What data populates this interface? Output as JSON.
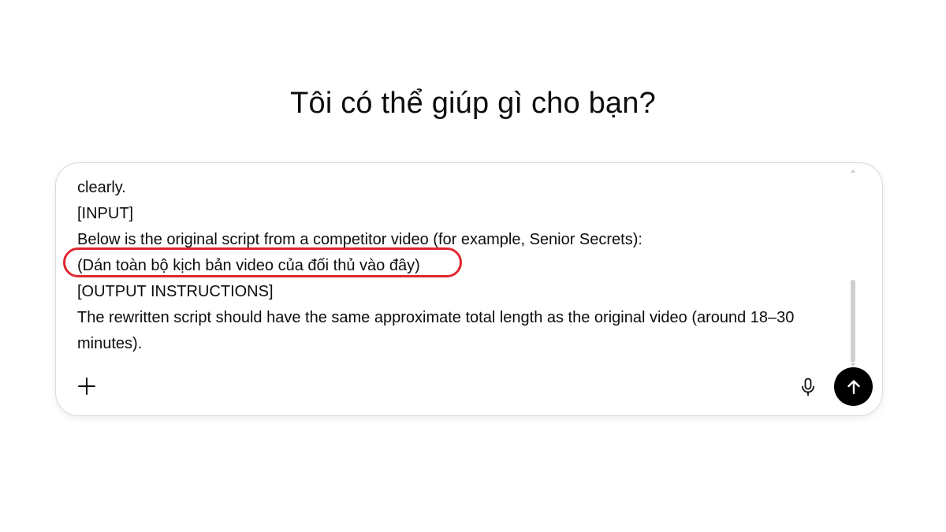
{
  "heading": "Tôi có thể giúp gì cho bạn?",
  "composer": {
    "lines": [
      "clearly.",
      "[INPUT]",
      "Below is the original script from a competitor video (for example, Senior Secrets):",
      "(Dán toàn bộ kịch bản video của đối thủ vào đây)",
      "[OUTPUT INSTRUCTIONS]",
      "The rewritten script should have the same approximate total length as the original video (around 18–30 minutes)."
    ],
    "highlighted_line_index": 3,
    "highlight_color": "#e0262d"
  },
  "icons": {
    "add": "plus-icon",
    "voice": "microphone-icon",
    "send": "arrow-up-icon"
  },
  "colors": {
    "send_button": "#000000",
    "text": "#0d0d0d",
    "border": "#d9d9d9"
  }
}
